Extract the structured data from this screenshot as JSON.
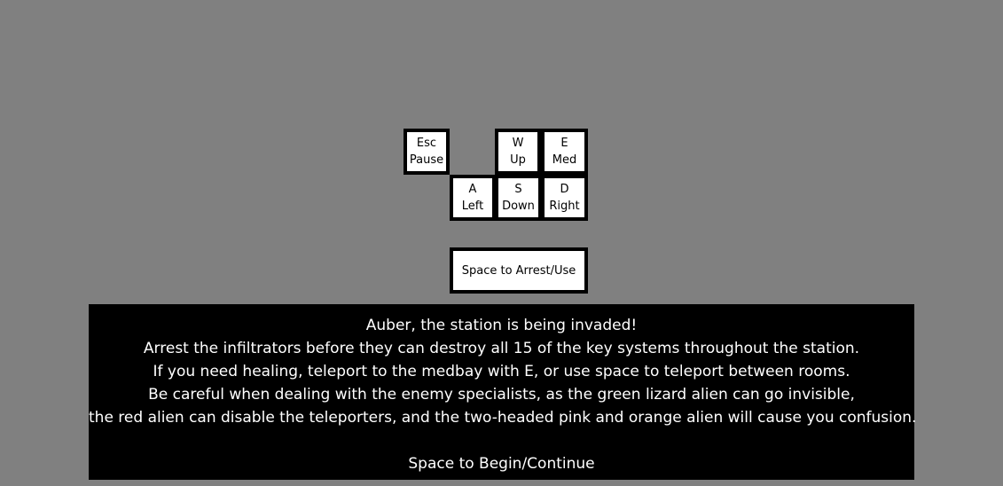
{
  "keys": {
    "esc": {
      "key": "Esc",
      "action": "Pause"
    },
    "w": {
      "key": "W",
      "action": "Up"
    },
    "e": {
      "key": "E",
      "action": "Med"
    },
    "a": {
      "key": "A",
      "action": "Left"
    },
    "s": {
      "key": "S",
      "action": "Down"
    },
    "d": {
      "key": "D",
      "action": "Right"
    },
    "space": {
      "label": "Space to Arrest/Use"
    }
  },
  "intro": {
    "lines": [
      "Auber, the station is being invaded!",
      "Arrest the infiltrators before they can destroy all 15 of the key systems throughout the station.",
      "If you need healing, teleport to the medbay with E, or use space to teleport between rooms.",
      "Be careful when dealing with the enemy specialists, as the green lizard alien can go invisible,",
      "the red alien can disable the teleporters, and the two-headed pink and orange alien will cause you confusion."
    ],
    "continue_prompt": "Space to Begin/Continue"
  },
  "colors": {
    "background": "#808080",
    "key_fill": "#ffffff",
    "key_border": "#000000",
    "panel_fill": "#000000",
    "panel_text": "#ffffff"
  }
}
